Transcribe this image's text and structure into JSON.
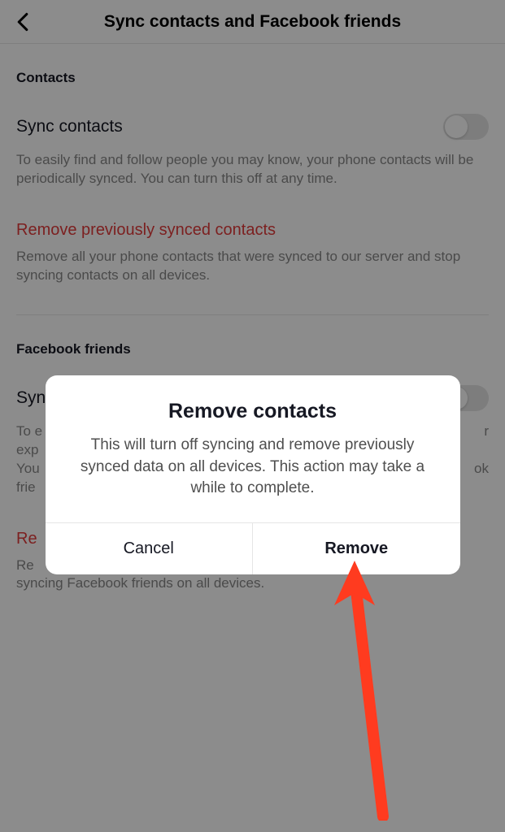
{
  "header": {
    "title": "Sync contacts and Facebook friends"
  },
  "sections": {
    "contacts": {
      "label": "Contacts",
      "sync": {
        "title": "Sync contacts",
        "description": "To easily find and follow people you may know, your phone contacts will be periodically synced. You can turn this off at any time."
      },
      "remove": {
        "title": "Remove previously synced contacts",
        "description": "Remove all your phone contacts that were synced to our server and stop syncing contacts on all devices."
      }
    },
    "facebook": {
      "label": "Facebook friends",
      "sync": {
        "title_prefix": "Syn",
        "description": "To easily find and follow people you may know and provide a better experience, your Facebook friends will be synced to our server. You can turn this off at any time to stop syncing Facebook friends.",
        "desc_p1": "To e",
        "desc_p2": "exp",
        "desc_p3": "You",
        "desc_p4": "frie",
        "desc_r1": "r",
        "desc_r2": "ok"
      },
      "remove": {
        "title_prefix": "Re",
        "desc_p1": "Re",
        "desc_p2": "syncing Facebook friends on all devices."
      }
    }
  },
  "dialog": {
    "title": "Remove contacts",
    "message": "This will turn off syncing and remove previously synced data on all devices. This action may take a while to complete.",
    "cancel": "Cancel",
    "confirm": "Remove"
  }
}
